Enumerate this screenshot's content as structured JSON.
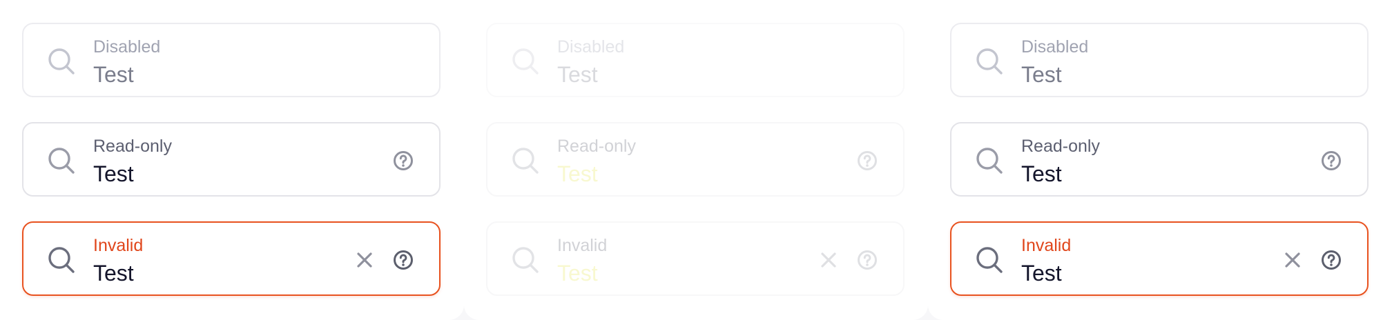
{
  "colors": {
    "border": "#e3e3e8",
    "invalid_border": "#e8521f",
    "invalid_label": "#e0461b",
    "text": "#14152b",
    "label": "#5c5f70",
    "icon": "#6b6e7d"
  },
  "columns": [
    {
      "fields": [
        {
          "label": "Disabled",
          "value": "Test",
          "icons": [
            "search-icon"
          ]
        },
        {
          "label": "Read-only",
          "value": "Test",
          "icons": [
            "search-icon",
            "help-icon"
          ]
        },
        {
          "label": "Invalid",
          "value": "Test",
          "icons": [
            "search-icon",
            "clear-icon",
            "help-icon"
          ]
        }
      ]
    },
    {
      "fields": [
        {
          "label": "Disabled",
          "value": "Test",
          "icons": [
            "search-icon"
          ]
        },
        {
          "label": "Read-only",
          "value": "Test",
          "icons": [
            "search-icon",
            "help-icon"
          ]
        },
        {
          "label": "Invalid",
          "value": "Test",
          "icons": [
            "search-icon",
            "clear-icon",
            "help-icon"
          ]
        }
      ]
    },
    {
      "fields": [
        {
          "label": "Disabled",
          "value": "Test",
          "icons": [
            "search-icon"
          ]
        },
        {
          "label": "Read-only",
          "value": "Test",
          "icons": [
            "search-icon",
            "help-icon"
          ]
        },
        {
          "label": "Invalid",
          "value": "Test",
          "icons": [
            "search-icon",
            "clear-icon",
            "help-icon"
          ]
        }
      ]
    }
  ]
}
